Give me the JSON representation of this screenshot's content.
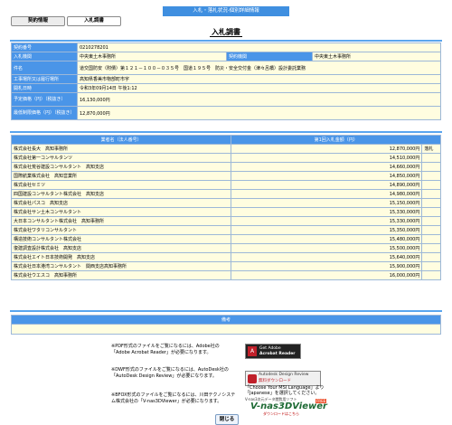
{
  "header": {
    "banner": "入札・落札状況-個別詳細情報",
    "tabs": [
      "契約情報",
      "入札調書"
    ],
    "title": "入札調書"
  },
  "info": [
    {
      "label": "契約番号",
      "value": "0210278201"
    },
    {
      "label": "入札機関",
      "value": "中央東土木事務所",
      "label2": "契約機関",
      "value2": "中央東土木事務所"
    },
    {
      "label": "件名",
      "value": "道交国防安（附債）第１２１－１００－０３５号　国道１９５号　防災・安全交付金（津々呂橋）設計委託業務"
    },
    {
      "label": "工事場所又は履行場所",
      "value": "高知県香美市物部町市宇"
    },
    {
      "label": "開札日時",
      "value": "令和3年09月14日 午後1:12"
    },
    {
      "label": "予定価格（円）（税抜き）",
      "value": "16,130,000円"
    },
    {
      "label": "最低制限価格（円）（税抜き）",
      "value": "12,870,000円"
    }
  ],
  "bids": {
    "columns": [
      "業者名（法人番号）",
      "第1回入札金額（円）",
      ""
    ],
    "rows": [
      {
        "name": "株式会社長大　高知事務所",
        "amount": "12,870,000円",
        "result": "落札"
      },
      {
        "name": "株式会社第一コンサルタンツ",
        "amount": "14,510,000円",
        "result": ""
      },
      {
        "name": "株式会社荒谷建設コンサルタント　高知支店",
        "amount": "14,660,000円",
        "result": ""
      },
      {
        "name": "国際航業株式会社　高知営業所",
        "amount": "14,850,000円",
        "result": ""
      },
      {
        "name": "株式会社セミツ",
        "amount": "14,890,000円",
        "result": ""
      },
      {
        "name": "四国建設コンサルタント株式会社　高知支店",
        "amount": "14,980,000円",
        "result": ""
      },
      {
        "name": "株式会社パスコ　高知支店",
        "amount": "15,150,000円",
        "result": ""
      },
      {
        "name": "株式会社サン土木コンサルタント",
        "amount": "15,330,000円",
        "result": ""
      },
      {
        "name": "大日本コンサルタント株式会社　高知事務所",
        "amount": "15,330,000円",
        "result": ""
      },
      {
        "name": "株式会社ワタリコンサルタント",
        "amount": "15,350,000円",
        "result": ""
      },
      {
        "name": "構造技術コンサルタント株式会社",
        "amount": "15,480,000円",
        "result": ""
      },
      {
        "name": "復建調査設計株式会社　高知支店",
        "amount": "15,500,000円",
        "result": ""
      },
      {
        "name": "株式会社エイト日本技術開発　高知支店",
        "amount": "15,640,000円",
        "result": ""
      },
      {
        "name": "株式会社日本港湾コンサルタント　関西支店高知事務所",
        "amount": "15,900,000円",
        "result": ""
      },
      {
        "name": "株式会社ウエスコ　高知事務所",
        "amount": "16,000,000円",
        "result": ""
      }
    ]
  },
  "notes": {
    "header": "備考",
    "value": ""
  },
  "footer": {
    "pdf_text": "※PDF形式のファイルをご覧になるには、Adobe社の「Adobe Acrobat Reader」が必要になります。",
    "pdf_badge_l1": "Get Adobe",
    "pdf_badge_l2": "Acrobat Reader",
    "dwf_text": "※DWF形式のファイルをご覧になるには、AutoDesk社の「AutoDesk Design Review」が必要になります。",
    "dwf_badge_l1": "Autodesk Design Review",
    "dwf_badge_l2": "無料ダウンロード",
    "dwf_lang_note": "「Choose Your MSI Language」より「Japanese」を選択してください。",
    "bfox_text": "※BFOX形式のファイルをご覧になるには、川田テクノシステム株式会社の「V-nas3DViewer」が必要になります。",
    "vnas_l1": "V-nas3次元データ閲覧用ソフト",
    "vnas_l2": "V-nas3DViewer",
    "vnas_free": "FREE",
    "vnas_l3": "ダウンロードはこちら"
  },
  "close_label": "閉じる",
  "colors": {
    "header_blue": "#4a95e8",
    "value_yellow": "#fffde0",
    "banner": "#3f8fe0"
  }
}
